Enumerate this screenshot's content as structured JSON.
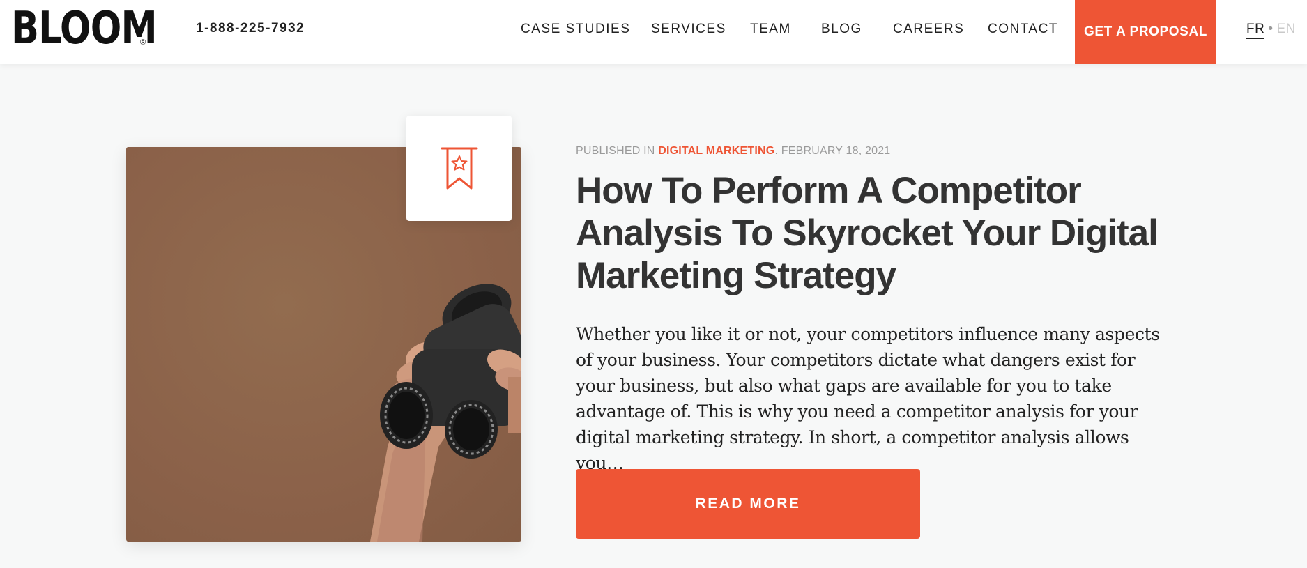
{
  "header": {
    "logo_text": "BLOOM",
    "logo_registered": "®",
    "phone": "1-888-225-7932",
    "nav": [
      {
        "label": "CASE STUDIES"
      },
      {
        "label": "SERVICES"
      },
      {
        "label": "TEAM"
      },
      {
        "label": "BLOG"
      },
      {
        "label": "CAREERS"
      },
      {
        "label": "CONTACT"
      }
    ],
    "cta_label": "GET A PROPOSAL",
    "lang": {
      "fr": "FR",
      "separator": "•",
      "en": "EN"
    }
  },
  "article": {
    "published_prefix": "PUBLISHED IN ",
    "category": "DIGITAL MARKETING",
    "date": ". FEBRUARY 18, 2021",
    "title": "How To Perform A Competitor Analysis To Skyrocket Your Digital Marketing Strategy",
    "excerpt": "Whether you like it or not, your competitors influence many aspects of your business. Your competitors dictate what dangers exist for your business, but also what gaps are available for you to take advantage of. This is why you need a competitor analysis for your digital marketing strategy. In short, a competitor analysis allows you…",
    "read_more_label": "READ MORE",
    "badge_icon": "bookmark-star-icon",
    "image_subject": "binoculars-photo"
  },
  "colors": {
    "accent": "#ee5535",
    "text_dark": "#333333",
    "meta_gray": "#9a9a9a",
    "background": "#f7f8f8"
  }
}
